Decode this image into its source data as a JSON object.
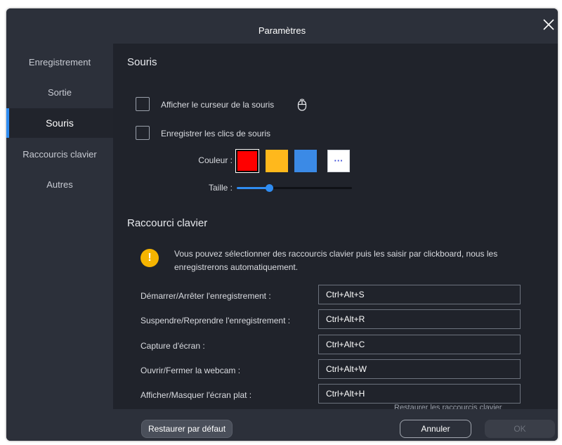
{
  "window": {
    "title": "Paramètres"
  },
  "sidebar": {
    "items": [
      {
        "label": "Enregistrement"
      },
      {
        "label": "Sortie"
      },
      {
        "label": "Souris"
      },
      {
        "label": "Raccourcis clavier"
      },
      {
        "label": "Autres"
      }
    ],
    "active_index": 2
  },
  "mouse_section": {
    "title": "Souris",
    "show_cursor_label": "Afficher le curseur de la souris",
    "record_clicks_label": "Enregistrer les clics de souris",
    "color_label": "Couleur :",
    "size_label": "Taille :",
    "swatches": [
      "#ff0000",
      "#ffb81c",
      "#3b8ae6"
    ],
    "size_value_fraction": 0.28
  },
  "shortcut_section": {
    "title": "Raccourci clavier",
    "info_text": "Vous pouvez sélectionner des raccourcis clavier puis les saisir par clickboard, nous les enregistrerons automatiquement.",
    "rows": [
      {
        "label": "Démarrer/Arrêter l'enregistrement :",
        "value": "Ctrl+Alt+S"
      },
      {
        "label": "Suspendre/Reprendre l'enregistrement :",
        "value": "Ctrl+Alt+R"
      },
      {
        "label": "Capture d'écran :",
        "value": "Ctrl+Alt+C"
      },
      {
        "label": "Ouvrir/Fermer la webcam :",
        "value": "Ctrl+Alt+W"
      },
      {
        "label": "Afficher/Masquer l'écran plat :",
        "value": "Ctrl+Alt+H"
      }
    ],
    "restore_link": "Restaurer les raccourcis clavier"
  },
  "footer": {
    "restore_default": "Restaurer par défaut",
    "cancel": "Annuler",
    "ok": "OK"
  },
  "colors": {
    "accent": "#2f8cf1",
    "warning": "#f5b400"
  }
}
